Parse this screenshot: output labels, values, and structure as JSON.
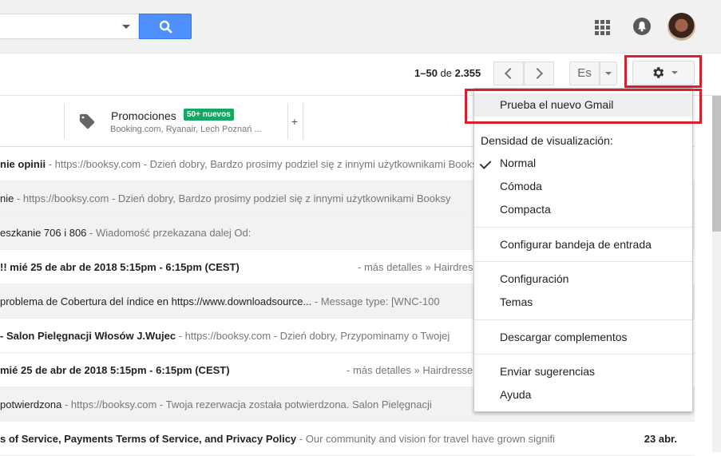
{
  "header": {
    "search_placeholder": "",
    "apps_icon": "apps-grid-icon",
    "notifications_icon": "bell-icon",
    "avatar_icon": "avatar"
  },
  "toolbar": {
    "pager_range": "1–50",
    "pager_of": "de",
    "pager_total": "2.355",
    "lang_label": "Es",
    "gear_icon": "gear-icon"
  },
  "tabs": {
    "promotions": {
      "title": "Promociones",
      "badge": "50+ nuevos",
      "senders": "Booking.com, Ryanair, Lech Poznań ..."
    },
    "add_label": "+"
  },
  "emails": [
    {
      "subject": "nie opinii",
      "snippet": " - https://booksy.com - Dzień dobry, Bardzo prosimy podziel się z innymi użytkownikami Booksy",
      "more": "",
      "unread": true
    },
    {
      "subject": "nie",
      "snippet": " - https://booksy.com - Dzień dobry, Bardzo prosimy podziel się z innymi użytkownikami Booksy",
      "more": "",
      "unread": false
    },
    {
      "subject": "eszkanie 706 i 806",
      "snippet": " -  Wiadomość przekazana dalej Od:",
      "more": "",
      "unread": false
    },
    {
      "subject": "!! mié 25 de abr de 2018 5:15pm - 6:15pm (CEST)",
      "snippet": "",
      "more": "- más detalles » Hairdresser",
      "unread": true
    },
    {
      "subject": "problema de Cobertura del índice en https://www.downloadsource...",
      "snippet": " - Message type: [WNC-100",
      "more": "",
      "unread": false
    },
    {
      "subject": "- Salon Pielęgnacji Włosów J.Wujec",
      "snippet": " - https://booksy.com - Dzień dobry, Przypominamy o Twojej",
      "more": "",
      "unread": true
    },
    {
      "subject": "mié 25 de abr de 2018 5:15pm - 6:15pm (CEST)",
      "snippet": "",
      "more": "- más detalles » Hairdresser",
      "unread": true
    },
    {
      "subject": "potwierdzona",
      "snippet": " - https://booksy.com - Twoja rezerwacja została potwierdzona. Salon Pielęgnacji",
      "more": "",
      "unread": true
    },
    {
      "subject": "s of Service, Payments Terms of Service, and Privacy Policy",
      "snippet": " - Our community and vision for travel have grown signifi",
      "more": "",
      "unread": true,
      "date": "23 abr."
    }
  ],
  "settings_menu": {
    "try_new": "Prueba el nuevo Gmail",
    "density_label": "Densidad de visualización:",
    "density_options": [
      "Normal",
      "Cómoda",
      "Compacta"
    ],
    "density_selected": "Normal",
    "configure_inbox": "Configurar bandeja de entrada",
    "settings": "Configuración",
    "themes": "Temas",
    "addons": "Descargar complementos",
    "feedback": "Enviar sugerencias",
    "help": "Ayuda"
  },
  "colors": {
    "search_button": "#4d90fe",
    "highlight_box": "#d9202c",
    "badge": "#16a765"
  }
}
